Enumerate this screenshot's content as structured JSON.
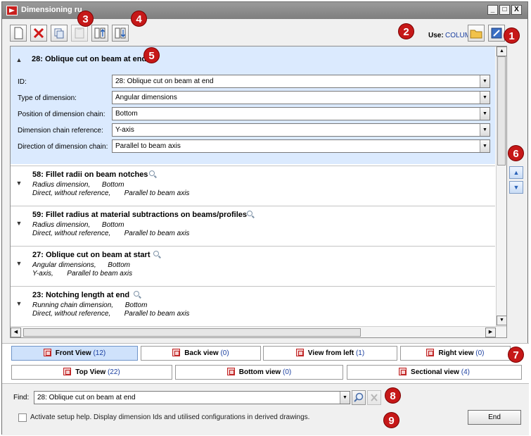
{
  "window": {
    "title": "Dimensioning ru",
    "min_label": "_",
    "max_label": "□",
    "close_label": "X"
  },
  "toolbar": {
    "use_label": "Use:",
    "use_value": "COLUMN",
    "buttons": [
      "new-icon",
      "delete-icon",
      "copy-icon",
      "paste-icon",
      "move-up-icon",
      "move-down-icon",
      "open-folder-icon",
      "configure-icon"
    ]
  },
  "badges": [
    "1",
    "2",
    "3",
    "4",
    "5",
    "6",
    "7",
    "8",
    "9"
  ],
  "expanded_item": {
    "title": "28: Oblique cut on beam at end",
    "fields": [
      {
        "label": "ID:",
        "value": "28: Oblique cut on beam at end"
      },
      {
        "label": "Type of dimension:",
        "value": "Angular dimensions"
      },
      {
        "label": "Position of dimension chain:",
        "value": "Bottom"
      },
      {
        "label": "Dimension chain reference:",
        "value": "Y-axis"
      },
      {
        "label": "Direction of dimension chain:",
        "value": "Parallel to beam axis"
      }
    ]
  },
  "items": [
    {
      "title": "58: Fillet radii on beam notches",
      "line1": "Radius dimension,      Bottom",
      "line2": "Direct, without reference,       Parallel to beam axis"
    },
    {
      "title": "59: Fillet radius at material subtractions on beams/profiles",
      "line1": "Radius dimension,      Bottom",
      "line2": "Direct, without reference,       Parallel to beam axis"
    },
    {
      "title": "27: Oblique cut on beam at start",
      "line1": "Angular dimensions,      Bottom",
      "line2": "Y-axis,       Parallel to beam axis"
    },
    {
      "title": "23: Notching length at end",
      "line1": "Running chain dimension,      Bottom",
      "line2": "Direct, without reference,       Parallel to beam axis"
    }
  ],
  "views": [
    {
      "name": "Front View",
      "count": "(12)"
    },
    {
      "name": "Back view",
      "count": "(0)"
    },
    {
      "name": "View from left",
      "count": "(1)"
    },
    {
      "name": "Right view",
      "count": "(0)"
    },
    {
      "name": "Top View",
      "count": "(22)"
    },
    {
      "name": "Bottom view",
      "count": "(0)"
    },
    {
      "name": "Sectional view",
      "count": "(4)"
    }
  ],
  "find": {
    "label": "Find:",
    "value": "28: Oblique cut on beam at end"
  },
  "setup_help": {
    "label": "Activate setup help. Display dimension Ids and utilised configurations in derived drawings.",
    "checked": false
  },
  "end_button": "End"
}
